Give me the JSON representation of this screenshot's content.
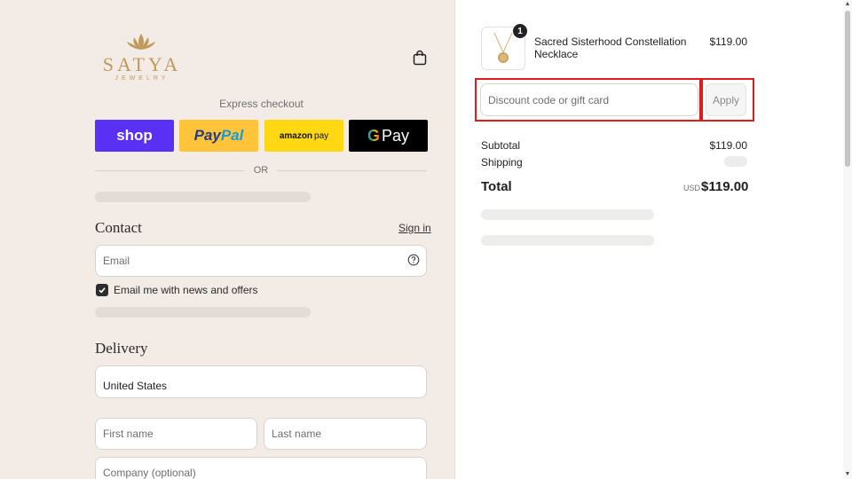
{
  "brand": {
    "name": "SATYA",
    "tagline": "JEWELRY",
    "color": "#c09a5b"
  },
  "express": {
    "label": "Express checkout",
    "shop_label": "shop",
    "paypal_part1": "Pay",
    "paypal_part2": "Pal",
    "amazon_part1": "amazon",
    "amazon_part2": "pay",
    "gpay_g": "G",
    "gpay_pay": "Pay",
    "or_label": "OR"
  },
  "contact": {
    "title": "Contact",
    "signin_label": "Sign in",
    "email_placeholder": "Email",
    "newsletter_label": "Email me with news and offers",
    "newsletter_checked": true
  },
  "delivery": {
    "title": "Delivery",
    "country_value": "United States",
    "first_name_placeholder": "First name",
    "last_name_placeholder": "Last name",
    "company_placeholder": "Company (optional)"
  },
  "order": {
    "product_name": "Sacred Sisterhood Constellation Necklace",
    "product_price": "$119.00",
    "quantity": "1",
    "discount_placeholder": "Discount code or gift card",
    "apply_label": "Apply",
    "subtotal_label": "Subtotal",
    "subtotal_value": "$119.00",
    "shipping_label": "Shipping",
    "total_label": "Total",
    "total_currency": "USD",
    "total_value": "$119.00"
  },
  "colors": {
    "shop_purple": "#5a31f4",
    "paypal_yellow": "#ffc439",
    "amazon_yellow": "#ffd814",
    "highlight_red": "#e01b1b"
  }
}
